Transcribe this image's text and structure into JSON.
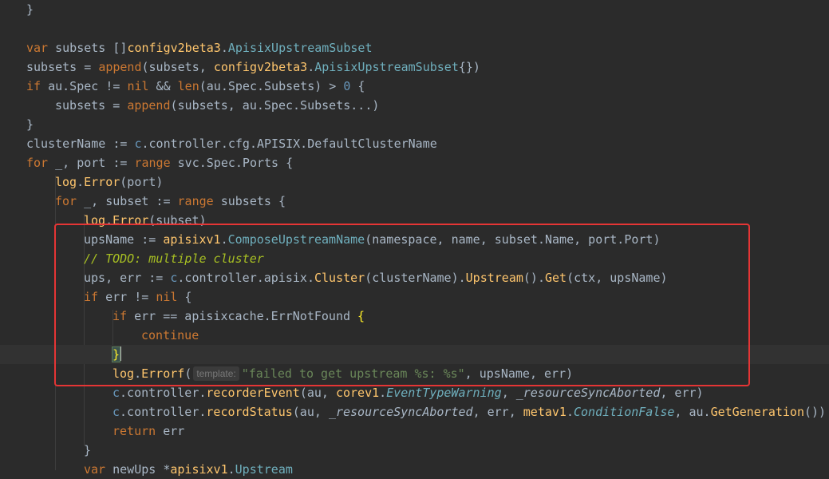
{
  "lines": [
    [
      "}"
    ],
    [],
    [
      "var",
      " subsets []",
      "configv2beta3",
      ".",
      "ApisixUpstreamSubset"
    ],
    [
      "subsets = ",
      "append",
      "(subsets, ",
      "configv2beta3",
      ".",
      "ApisixUpstreamSubset",
      "{})"
    ],
    [
      "if",
      " au.Spec != ",
      "nil",
      " && ",
      "len",
      "(au.Spec.Subsets) > ",
      "0",
      " {"
    ],
    [
      "subsets = ",
      "append",
      "(subsets, au.Spec.Subsets...)"
    ],
    [
      "}"
    ],
    [
      "clusterName := ",
      "c",
      ".controller.cfg.APISIX.DefaultClusterName"
    ],
    [
      "for",
      " _, port := ",
      "range",
      " svc.Spec.Ports {"
    ],
    [
      "log",
      ".",
      "Error",
      "(port)"
    ],
    [
      "for",
      " _, subset := ",
      "range",
      " subsets {"
    ],
    [
      "log",
      ".",
      "Error",
      "(subset)"
    ],
    [
      "upsName := ",
      "apisixv1",
      ".",
      "ComposeUpstreamName",
      "(namespace, name, subset.Name, port.Port)"
    ],
    [
      "// TODO: multiple cluster"
    ],
    [
      "ups, err := ",
      "c",
      ".controller.apisix.",
      "Cluster",
      "(clusterName).",
      "Upstream",
      "().",
      "Get",
      "(ctx, upsName)"
    ],
    [
      "if",
      " err != ",
      "nil",
      " {"
    ],
    [
      "if",
      " err == apisixcache.ErrNotFound ",
      "{"
    ],
    [
      "continue"
    ],
    [
      "}"
    ],
    [
      "log",
      ".",
      "Errorf",
      "(",
      "template:",
      "\"failed to get upstream %s: %s\"",
      ", upsName, err)"
    ],
    [
      "c",
      ".controller.",
      "recorderEvent",
      "(au, ",
      "corev1",
      ".",
      "EventTypeWarning",
      ", ",
      "_resourceSyncAborted",
      ", err)"
    ],
    [
      "c",
      ".controller.",
      "recordStatus",
      "(au, ",
      "_resourceSyncAborted",
      ", err, ",
      "metav1",
      ".",
      "ConditionFalse",
      ", au.",
      "GetGeneration",
      "())"
    ],
    [
      "return",
      " err"
    ],
    [
      "}"
    ],
    [
      "var",
      " newUps *",
      "apisixv1",
      ".",
      "Upstream"
    ]
  ]
}
